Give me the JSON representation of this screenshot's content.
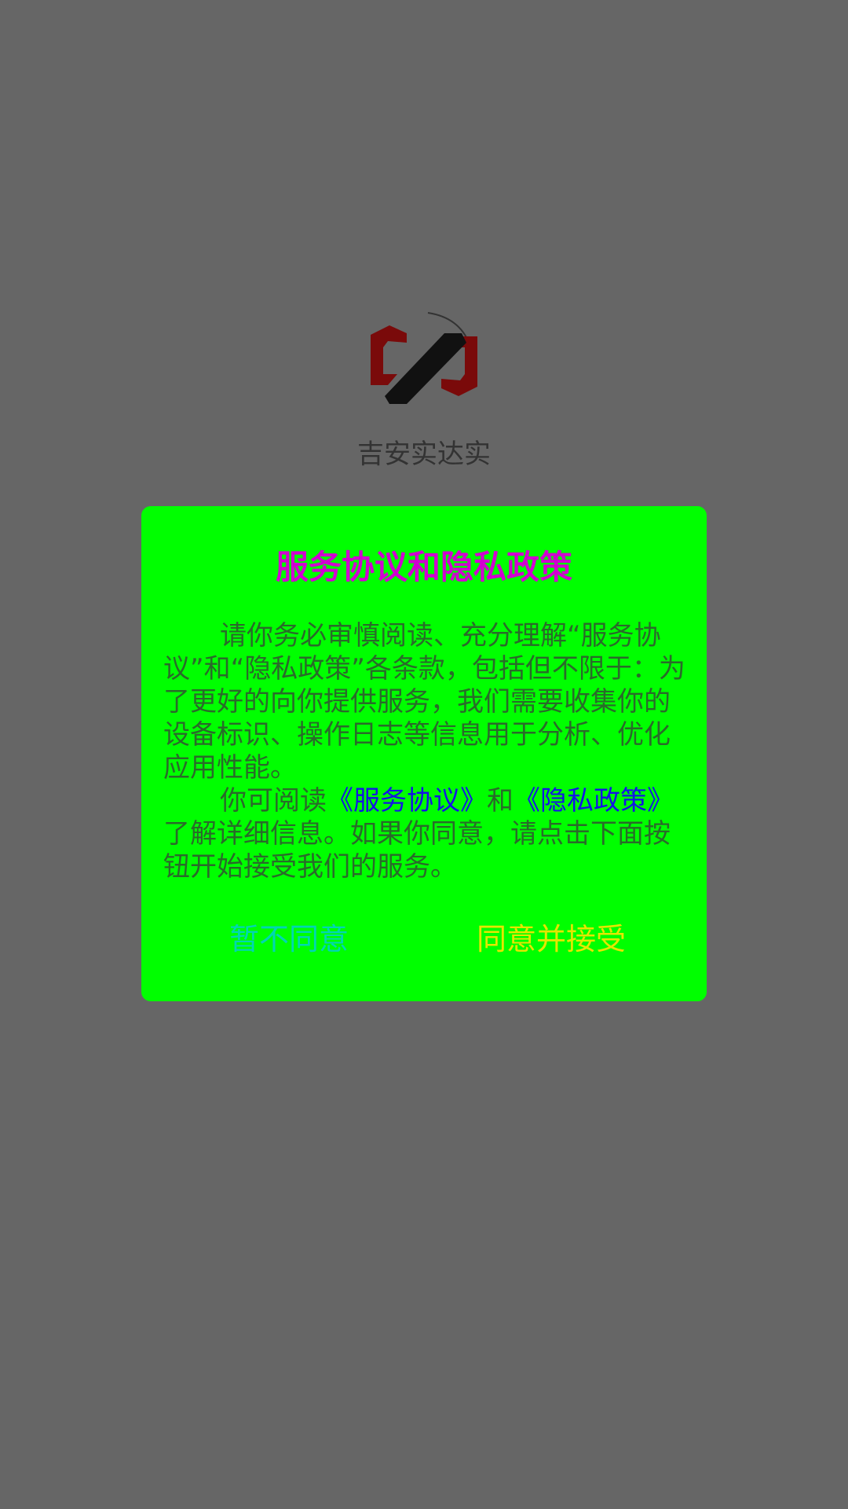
{
  "app": {
    "name": "吉安实达实",
    "logo_icon": "app-logo-icon"
  },
  "colors": {
    "overlay_background": "#666666",
    "dialog_background": "#00ff00",
    "title": "#d100d1",
    "body_text": "#2a6a2a",
    "link": "#1414e6",
    "decline_button": "#00d6b4",
    "accept_button": "#e6e600"
  },
  "dialog": {
    "title": "服务协议和隐私政策",
    "paragraph1": "请你务必审慎阅读、充分理解“服务协议”和“隐私政策”各条款，包括但不限于：为了更好的向你提供服务，我们需要收集你的设备标识、操作日志等信息用于分析、优化应用性能。",
    "paragraph2_prefix": "你可阅读",
    "service_agreement_link": "《服务协议》",
    "paragraph2_and": "和",
    "privacy_policy_link": "《隐私政策》",
    "paragraph2_suffix": "了解详细信息。如果你同意，请点击下面按钮开始接受我们的服务。",
    "decline_label": "暂不同意",
    "accept_label": "同意并接受"
  }
}
